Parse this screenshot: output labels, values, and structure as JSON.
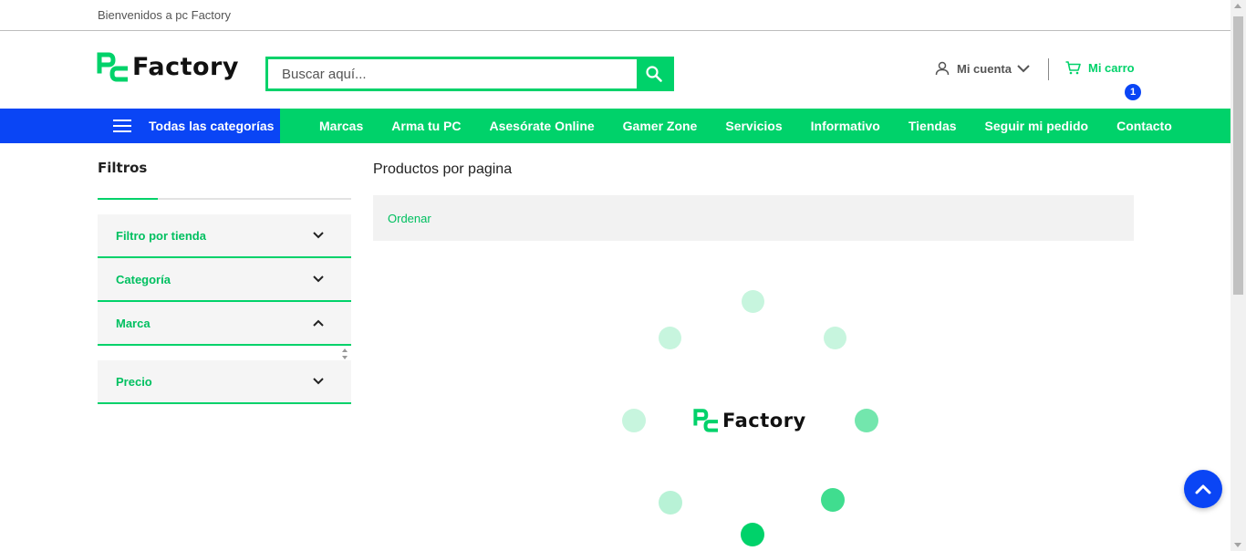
{
  "topbar": {
    "welcome": "Bienvenidos a pc Factory"
  },
  "brand": {
    "logo_text": "Factory",
    "color_primary": "#00d26a",
    "color_secondary": "#0a45f5"
  },
  "search": {
    "placeholder": "Buscar aquí...",
    "value": "",
    "icon": "search-icon"
  },
  "account": {
    "label": "Mi cuenta",
    "icon": "user-icon"
  },
  "cart": {
    "label": "Mi carro",
    "count": "1",
    "icon": "cart-icon"
  },
  "nav": {
    "all_categories": "Todas las categorías",
    "links": [
      "Marcas",
      "Arma tu PC",
      "Asesórate Online",
      "Gamer Zone",
      "Servicios",
      "Informativo",
      "Tiendas",
      "Seguir mi pedido",
      "Contacto"
    ]
  },
  "sidebar": {
    "title": "Filtros",
    "filters": [
      {
        "label": "Filtro por tienda",
        "expanded": false
      },
      {
        "label": "Categoría",
        "expanded": false
      },
      {
        "label": "Marca",
        "expanded": true
      },
      {
        "label": "Precio",
        "expanded": false
      }
    ]
  },
  "main": {
    "title": "Productos por pagina",
    "sort_label": "Ordenar"
  },
  "loader": {
    "logo_text": "Factory"
  }
}
